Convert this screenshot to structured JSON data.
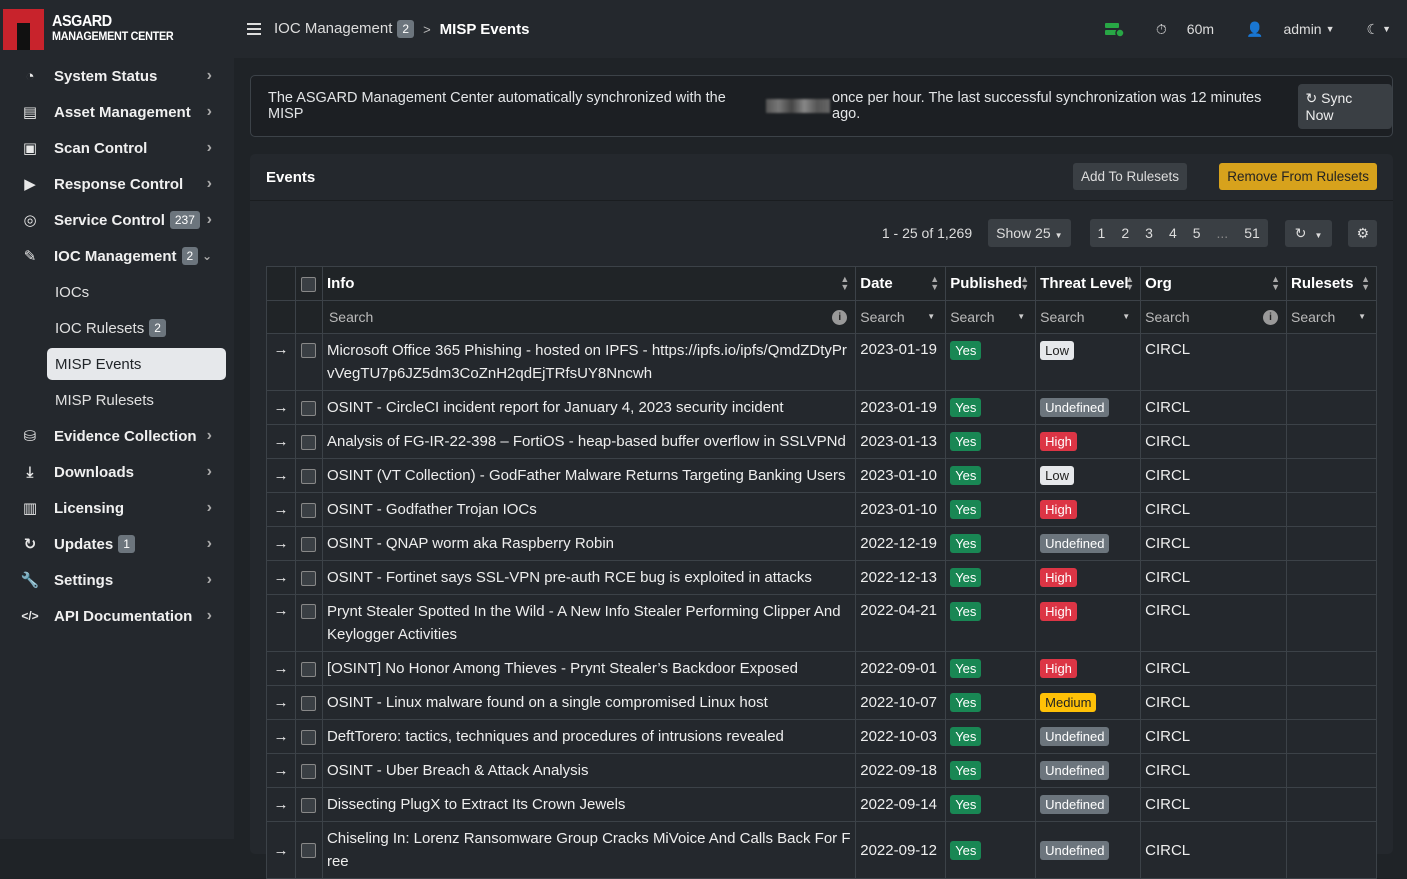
{
  "brand": {
    "line1": "ASGARD",
    "line2": "MANAGEMENT CENTER"
  },
  "sidebar": {
    "items": [
      {
        "label": "System Status",
        "icon": "gauge-icon"
      },
      {
        "label": "Asset Management",
        "icon": "server-icon"
      },
      {
        "label": "Scan Control",
        "icon": "scan-icon"
      },
      {
        "label": "Response Control",
        "icon": "play-icon"
      },
      {
        "label": "Service Control",
        "icon": "target-icon",
        "badge": "237"
      },
      {
        "label": "IOC Management",
        "icon": "ioc-icon",
        "badge": "2"
      },
      {
        "label": "Evidence Collection",
        "icon": "evidence-icon"
      },
      {
        "label": "Downloads",
        "icon": "download-icon"
      },
      {
        "label": "Licensing",
        "icon": "license-icon"
      },
      {
        "label": "Updates",
        "icon": "refresh-icon",
        "badge": "1"
      },
      {
        "label": "Settings",
        "icon": "wrench-icon"
      },
      {
        "label": "API Documentation",
        "icon": "code-icon"
      }
    ],
    "sub_items": [
      {
        "label": "IOCs"
      },
      {
        "label": "IOC Rulesets",
        "badge": "2"
      },
      {
        "label": "MISP Events"
      },
      {
        "label": "MISP Rulesets"
      }
    ]
  },
  "topbar": {
    "crumb1": "IOC Management",
    "crumb1_badge": "2",
    "crumb_sep": ">",
    "crumb2": "MISP Events",
    "timer": "60m",
    "user": "admin"
  },
  "alert": {
    "text_before": "The ASGARD Management Center automatically synchronized with the MISP",
    "text_after": "once per hour. The last successful synchronization was 12 minutes ago.",
    "sync_label": "Sync Now"
  },
  "card": {
    "title": "Events",
    "add_label": "Add To Rulesets",
    "remove_label": "Remove From Rulesets"
  },
  "toolbar": {
    "range": "1 - 25 of 1,269",
    "show": "Show 25",
    "pages": [
      "1",
      "2",
      "3",
      "4",
      "5",
      "...",
      "51"
    ]
  },
  "table": {
    "headers": [
      "Info",
      "Date",
      "Published",
      "Threat Level",
      "Org",
      "Rulesets"
    ],
    "search_placeholder": "Search",
    "rows": [
      {
        "info": "Microsoft Office 365 Phishing - hosted on IPFS - https://ipfs.io/ipfs/QmdZDtyPrvVegTU7p6JZ5dm3CoZnH2qdEjTRfsUY8Nncwh",
        "date": "2023-01-19",
        "published": "Yes",
        "threat": "Low",
        "org": "CIRCL"
      },
      {
        "info": "OSINT - CircleCI incident report for January 4, 2023 security incident",
        "date": "2023-01-19",
        "published": "Yes",
        "threat": "Undefined",
        "org": "CIRCL"
      },
      {
        "info": "Analysis of FG-IR-22-398 – FortiOS - heap-based buffer overflow in SSLVPNd",
        "date": "2023-01-13",
        "published": "Yes",
        "threat": "High",
        "org": "CIRCL"
      },
      {
        "info": "OSINT (VT Collection) - GodFather Malware Returns Targeting Banking Users",
        "date": "2023-01-10",
        "published": "Yes",
        "threat": "Low",
        "org": "CIRCL"
      },
      {
        "info": "OSINT - Godfather Trojan IOCs",
        "date": "2023-01-10",
        "published": "Yes",
        "threat": "High",
        "org": "CIRCL"
      },
      {
        "info": "OSINT - QNAP worm aka Raspberry Robin",
        "date": "2022-12-19",
        "published": "Yes",
        "threat": "Undefined",
        "org": "CIRCL"
      },
      {
        "info": "OSINT - Fortinet says SSL-VPN pre-auth RCE bug is exploited in attacks",
        "date": "2022-12-13",
        "published": "Yes",
        "threat": "High",
        "org": "CIRCL"
      },
      {
        "info": "Prynt Stealer Spotted In the Wild - A New Info Stealer Performing Clipper And Keylogger Activities",
        "date": "2022-04-21",
        "published": "Yes",
        "threat": "High",
        "org": "CIRCL"
      },
      {
        "info": "[OSINT] No Honor Among Thieves - Prynt Stealer’s Backdoor Exposed",
        "date": "2022-09-01",
        "published": "Yes",
        "threat": "High",
        "org": "CIRCL"
      },
      {
        "info": "OSINT - Linux malware found on a single compromised Linux host",
        "date": "2022-10-07",
        "published": "Yes",
        "threat": "Medium",
        "org": "CIRCL"
      },
      {
        "info": "DeftTorero: tactics, techniques and procedures of intrusions revealed",
        "date": "2022-10-03",
        "published": "Yes",
        "threat": "Undefined",
        "org": "CIRCL"
      },
      {
        "info": "OSINT - Uber Breach & Attack Analysis",
        "date": "2022-09-18",
        "published": "Yes",
        "threat": "Undefined",
        "org": "CIRCL"
      },
      {
        "info": "Dissecting PlugX to Extract Its Crown Jewels",
        "date": "2022-09-14",
        "published": "Yes",
        "threat": "Undefined",
        "org": "CIRCL"
      },
      {
        "info": "Chiseling In: Lorenz Ransomware Group Cracks MiVoice And Calls Back For Free",
        "date": "2022-09-12",
        "published": "Yes",
        "threat": "Undefined",
        "org": "CIRCL"
      }
    ]
  }
}
